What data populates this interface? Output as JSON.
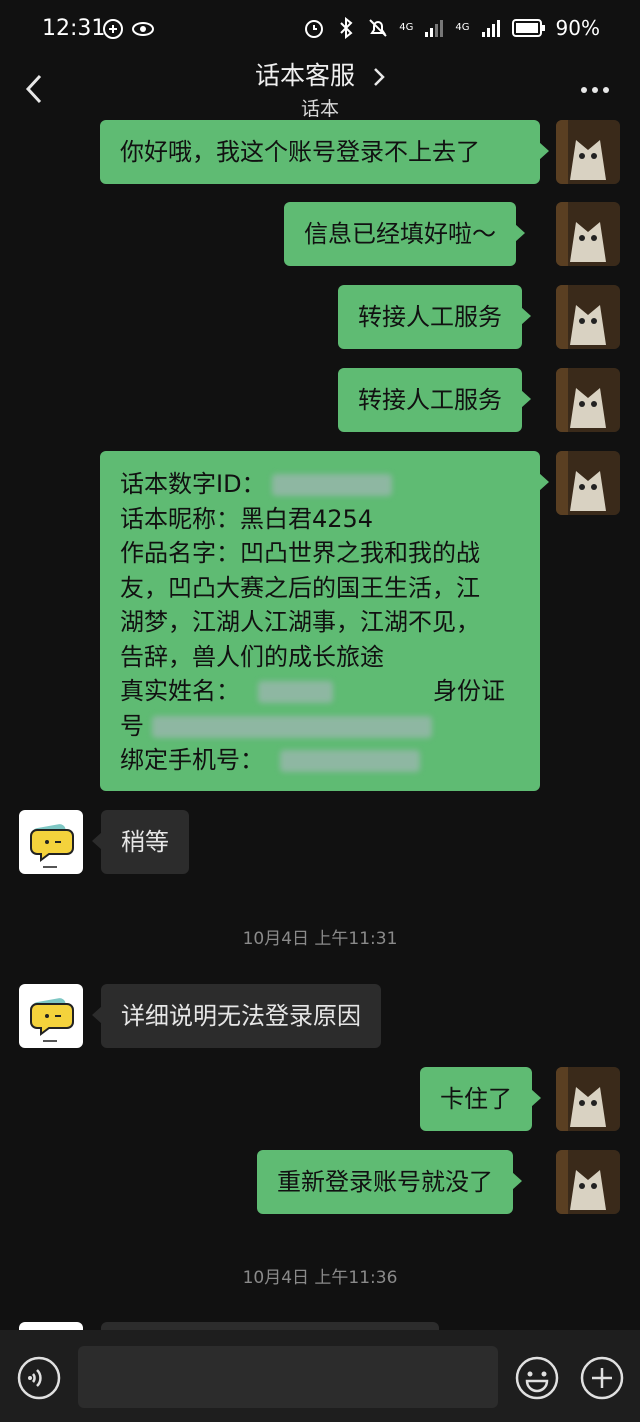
{
  "status": {
    "time": "12:31",
    "battery": "90%",
    "network1": "4G",
    "network2": "4G"
  },
  "nav": {
    "title": "话本客服",
    "subtitle": "话本"
  },
  "messages": {
    "m1": "你好哦，我这个账号登录不上去了",
    "m2": "信息已经填好啦～",
    "m3": "转接人工服务",
    "m4": "转接人工服务",
    "form": {
      "l1": "话本数字ID：",
      "l2": "话本昵称：黑白君4254",
      "l3": "作品名字：凹凸世界之我和我的战",
      "l4": "友，凹凸大赛之后的国王生活，江",
      "l5": "湖梦，江湖人江湖事，江湖不见，",
      "l6": "告辞，兽人们的成长旅途",
      "l7a": "真实姓名：",
      "l7b": "身份证",
      "l8": "号",
      "l9": "绑定手机号："
    },
    "bot1": "稍等",
    "ts1": "10月4日 上午11:31",
    "bot2": "详细说明无法登录原因",
    "m5": "卡住了",
    "m6": "重新登录账号就没了",
    "ts2": "10月4日 上午11:36"
  },
  "colors": {
    "accent": "#5fbb73",
    "bg": "#111111",
    "incoming": "#2c2c2c"
  }
}
